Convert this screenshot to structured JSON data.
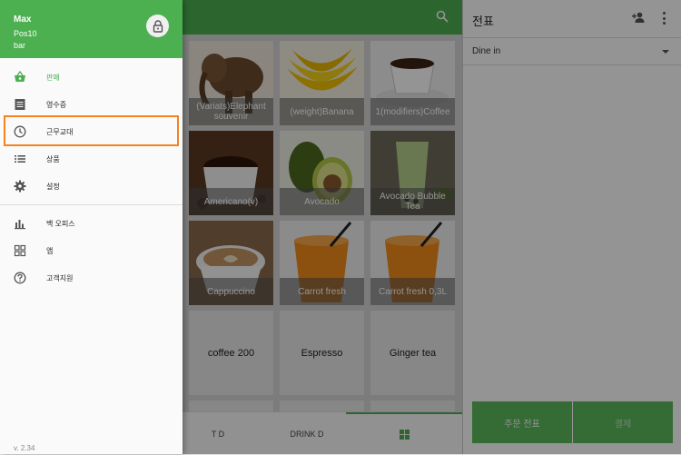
{
  "drawer": {
    "user_name": "Max",
    "pos_name": "Pos10",
    "store_name": "bar",
    "items": [
      {
        "label": "판매",
        "icon": "basket-icon",
        "selected": true
      },
      {
        "label": "영수증",
        "icon": "receipt-icon"
      },
      {
        "label": "근무교대",
        "icon": "clock-icon"
      },
      {
        "label": "상품",
        "icon": "list-icon"
      },
      {
        "label": "설정",
        "icon": "gear-icon"
      },
      {
        "label": "백 오피스",
        "icon": "bar-chart-icon"
      },
      {
        "label": "앱",
        "icon": "apps-icon"
      },
      {
        "label": "고객지원",
        "icon": "help-icon"
      }
    ],
    "version": "v. 2.34"
  },
  "products": [
    {
      "name": "(Variats)Elephant souvenir",
      "has_image": true
    },
    {
      "name": "(weight)Banana",
      "has_image": true
    },
    {
      "name": "1(modifiers)Coffee",
      "has_image": true
    },
    {
      "name": "Americano(v)",
      "has_image": true
    },
    {
      "name": "Avocado",
      "has_image": true
    },
    {
      "name": "Avocado Bubble Tea",
      "has_image": true
    },
    {
      "name": "Cappuccino",
      "has_image": true
    },
    {
      "name": "Carrot fresh",
      "has_image": true
    },
    {
      "name": "Carrot fresh 0,3L",
      "has_image": true
    },
    {
      "name": "coffee 200",
      "has_image": false
    },
    {
      "name": "Espresso",
      "has_image": false
    },
    {
      "name": "Ginger tea",
      "has_image": false
    }
  ],
  "bottom_tabs": [
    {
      "label": "T D"
    },
    {
      "label": "DRINK D"
    }
  ],
  "ticket": {
    "title": "전표",
    "dining_option": "Dine in",
    "save_label": "주문 전표",
    "pay_label": "결제"
  },
  "colors": {
    "accent": "#4caf50",
    "highlight": "#f58220"
  }
}
